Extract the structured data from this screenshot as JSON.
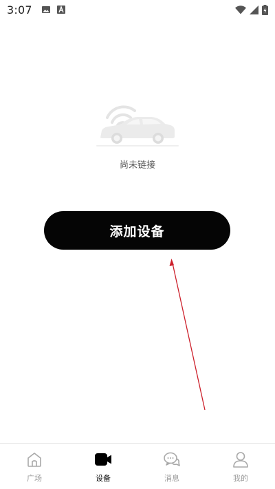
{
  "status_bar": {
    "time": "3:07",
    "left_icons": [
      "image-icon",
      "text-a-icon"
    ],
    "right_icons": [
      "wifi-icon",
      "signal-icon",
      "battery-icon"
    ]
  },
  "empty_state": {
    "illustration": "car-wireless-icon",
    "label": "尚未链接"
  },
  "add_button": {
    "label": "添加设备"
  },
  "annotation": {
    "color": "#cc1f2a"
  },
  "bottom_nav": {
    "items": [
      {
        "label": "广场",
        "icon": "home-icon",
        "active": false
      },
      {
        "label": "设备",
        "icon": "video-camera-icon",
        "active": true
      },
      {
        "label": "消息",
        "icon": "chat-bubble-icon",
        "active": false
      },
      {
        "label": "我的",
        "icon": "user-icon",
        "active": false
      }
    ]
  },
  "colors": {
    "primary": "#050505",
    "inactive": "#9a9a9a",
    "background": "#ffffff"
  }
}
